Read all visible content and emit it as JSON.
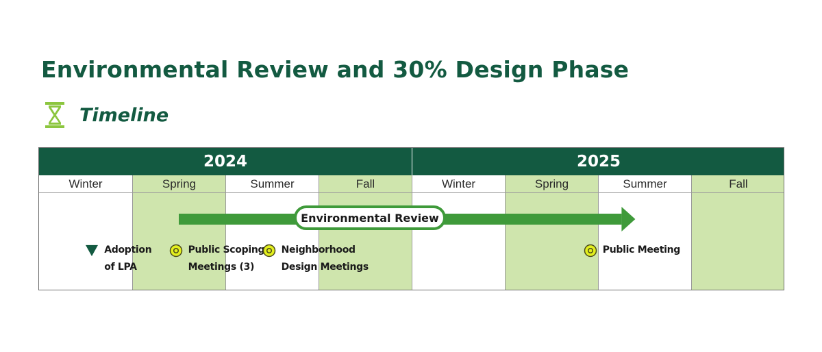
{
  "title": "Environmental Review and 30% Design Phase",
  "subtitle": "Timeline",
  "subtitle_icon": "hourglass-icon",
  "colors": {
    "title": "#135a41",
    "header_bg": "#135a41",
    "shaded_season": "#cfe5ad",
    "arrow": "#3f9a3a",
    "hourglass": "#8cc63f",
    "meeting_marker_fill": "#e3ef1e",
    "triangle_marker": "#135a41"
  },
  "years": [
    "2024",
    "2025"
  ],
  "seasons": [
    "Winter",
    "Spring",
    "Summer",
    "Fall",
    "Winter",
    "Spring",
    "Summer",
    "Fall"
  ],
  "bar": {
    "label": "Environmental Review",
    "start_season": 1.5,
    "end_season": 6.4
  },
  "milestones": [
    {
      "lines": [
        "Adoption",
        "of LPA"
      ],
      "marker": "triangle",
      "season_index": 0.7
    },
    {
      "lines": [
        "Public Scoping",
        "Meetings (3)"
      ],
      "marker": "circle",
      "season_index": 1.6
    },
    {
      "lines": [
        "Neighborhood",
        "Design Meetings"
      ],
      "marker": "circle",
      "season_index": 2.6
    },
    {
      "lines": [
        "Public Meeting"
      ],
      "marker": "circle",
      "season_index": 6.05
    }
  ]
}
